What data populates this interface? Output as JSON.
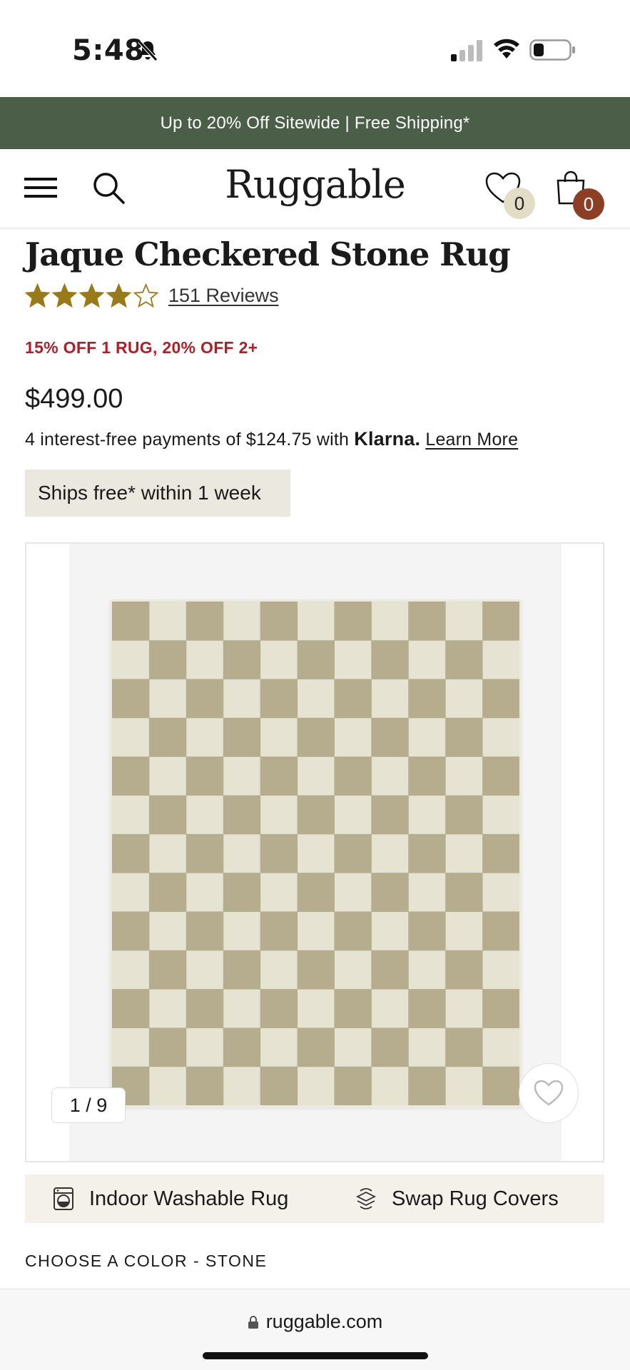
{
  "status_bar": {
    "time": "5:48"
  },
  "promo_banner": {
    "text": "Up to 20% Off Sitewide | Free Shipping*"
  },
  "header": {
    "brand": "Ruggable",
    "wishlist_count": "0",
    "cart_count": "0"
  },
  "product": {
    "title": "Jaque Checkered Stone Rug",
    "rating_stars": 4,
    "rating_max": 5,
    "reviews_label": "151 Reviews",
    "promo": "15% OFF 1 RUG, 20% OFF 2+",
    "price": "$499.00",
    "klarna": {
      "prefix": "4 interest-free payments of $124.75 with",
      "brand": "Klarna.",
      "link": "Learn More"
    },
    "shipping_badge": "Ships free* within 1 week"
  },
  "gallery": {
    "counter": "1 / 9",
    "current_image": 1,
    "total_images": 9
  },
  "features": {
    "washable": "Indoor Washable Rug",
    "swap": "Swap Rug Covers"
  },
  "color_selector": {
    "label": "CHOOSE A COLOR - STONE"
  },
  "browser": {
    "url": "ruggable.com"
  },
  "colors": {
    "banner_bg": "#4a5e48",
    "promo_red": "#b01e2a",
    "star_gold": "#9a7a18",
    "cart_badge": "#8c3f24",
    "wishlist_badge": "#e3dcc6",
    "rug_dark": "#b5ad8e",
    "rug_light": "#e6e3d3"
  }
}
